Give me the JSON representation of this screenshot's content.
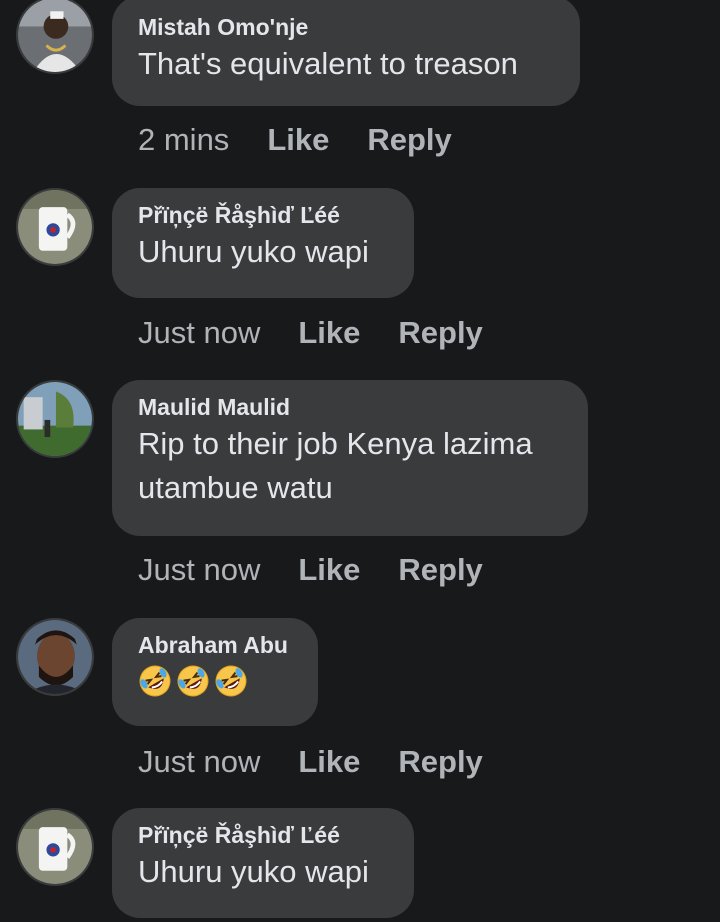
{
  "comments": [
    {
      "author": "Mistah Omo'nje",
      "text": "That's equivalent to treason",
      "time": "2 mins",
      "like_label": "Like",
      "reply_label": "Reply"
    },
    {
      "author": "Přïņçë Řåşhìď Ľéé",
      "text": "Uhuru yuko wapi",
      "time": "Just now",
      "like_label": "Like",
      "reply_label": "Reply"
    },
    {
      "author": "Maulid Maulid",
      "text": "Rip to their job Kenya lazima utambue watu",
      "time": "Just now",
      "like_label": "Like",
      "reply_label": "Reply"
    },
    {
      "author": "Abraham Abu",
      "text": "",
      "emojis": [
        "rolling-on-floor-laughing",
        "rolling-on-floor-laughing",
        "rolling-on-floor-laughing"
      ],
      "time": "Just now",
      "like_label": "Like",
      "reply_label": "Reply"
    },
    {
      "author": "Přïņçë Řåşhìď Ľéé",
      "text": "Uhuru yuko wapi"
    }
  ],
  "colors": {
    "background": "#18191a",
    "bubble": "#3a3b3c",
    "primary_text": "#e4e6eb",
    "secondary_text": "#b0b3b8"
  }
}
